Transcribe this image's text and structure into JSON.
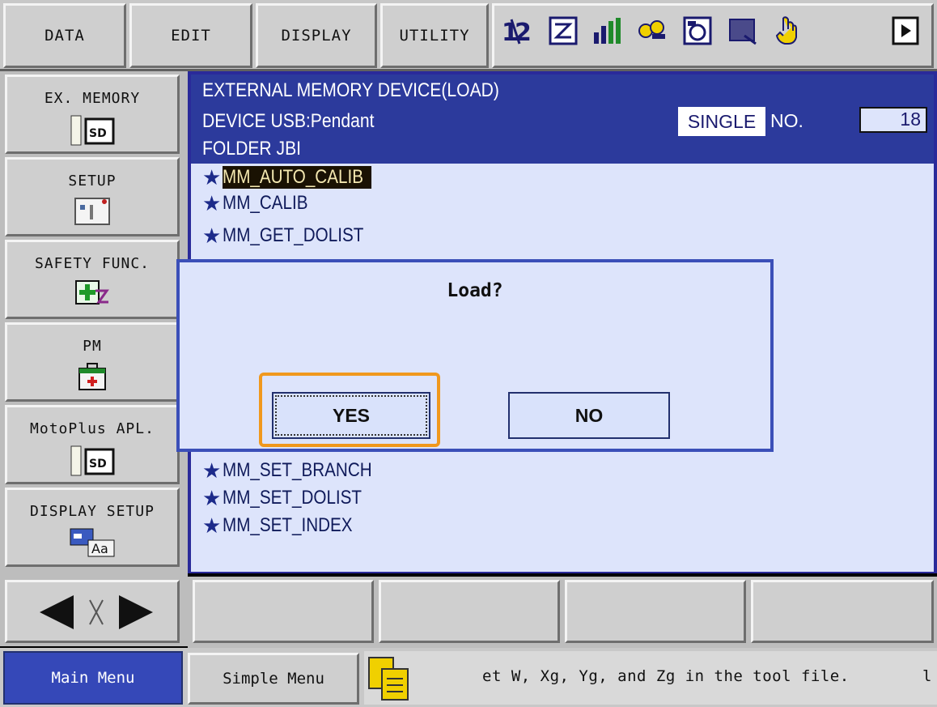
{
  "menu": {
    "data_label": "DATA",
    "edit_label": "EDIT",
    "display_label": "DISPLAY",
    "utility_label": "UTILITY"
  },
  "toolbar_icons": [
    "number-icon",
    "edit-icon",
    "chart-icon",
    "keys-icon",
    "stack-icon",
    "export-icon",
    "hand-pointer-icon",
    "play-icon"
  ],
  "sidebar": {
    "items": [
      {
        "label": "EX. MEMORY",
        "icon": "sd-card-icon"
      },
      {
        "label": "SETUP",
        "icon": "setup-panel-icon"
      },
      {
        "label": "SAFETY FUNC.",
        "icon": "safety-icon"
      },
      {
        "label": "PM",
        "icon": "first-aid-icon"
      },
      {
        "label": "MotoPlus APL.",
        "icon": "sd-card-icon"
      },
      {
        "label": "DISPLAY SETUP",
        "icon": "font-settings-icon"
      }
    ]
  },
  "header": {
    "title": "EXTERNAL MEMORY DEVICE(LOAD)",
    "device": "DEVICE USB:Pendant",
    "folder": "FOLDER JBI",
    "mode": "SINGLE",
    "no_label": "NO.",
    "no_value": "18"
  },
  "files": {
    "before": [
      {
        "name": "MM_AUTO_CALIB",
        "selected": true
      },
      {
        "name": "MM_CALIB",
        "selected": false
      },
      {
        "name": "MM_GET_DOLIST",
        "selected": false
      }
    ],
    "after": [
      {
        "name": "MM_SET_BRANCH"
      },
      {
        "name": "MM_SET_DOLIST"
      },
      {
        "name": "MM_SET_INDEX"
      }
    ]
  },
  "dialog": {
    "title": "Load?",
    "yes_label": "YES",
    "no_label": "NO"
  },
  "status": {
    "main_menu_label": "Main Menu",
    "simple_menu_label": "Simple Menu",
    "message": "et W, Xg, Yg, and Zg in the tool file.",
    "message_tail": "l"
  },
  "colors": {
    "header_bg": "#2c3a9c",
    "list_bg": "#dde4fb",
    "highlight": "#f0981d",
    "main_menu_bg": "#3548b8"
  }
}
